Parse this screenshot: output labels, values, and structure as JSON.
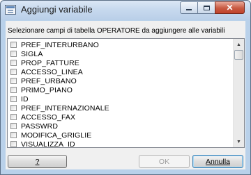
{
  "window": {
    "title": "Aggiungi variabile"
  },
  "titlebar_buttons": {
    "minimize_icon": "minimize-icon",
    "maximize_icon": "maximize-icon",
    "close_glyph": "✕"
  },
  "instruction": "Selezionare campi di tabella OPERATORE da aggiungere alle variabili",
  "list": {
    "items": [
      {
        "label": "PREF_INTERURBANO",
        "checked": false
      },
      {
        "label": "SIGLA",
        "checked": false
      },
      {
        "label": "PROP_FATTURE",
        "checked": false
      },
      {
        "label": "ACCESSO_LINEA",
        "checked": false
      },
      {
        "label": "PREF_URBANO",
        "checked": false
      },
      {
        "label": "PRIMO_PIANO",
        "checked": false
      },
      {
        "label": "ID",
        "checked": false
      },
      {
        "label": "PREF_INTERNAZIONALE",
        "checked": false
      },
      {
        "label": "ACCESSO_FAX",
        "checked": false
      },
      {
        "label": "PASSWRD",
        "checked": false
      },
      {
        "label": "MODIFICA_GRIGLIE",
        "checked": false
      },
      {
        "label": "VISUALIZZA_ID",
        "checked": false
      }
    ]
  },
  "buttons": {
    "help_label": "?",
    "ok_label": "OK",
    "cancel_label": "Annulla"
  },
  "colors": {
    "titlebar": "#c7d9ee",
    "close_button": "#c85a42",
    "dialog_background": "#f0f0f0",
    "default_button_border": "#3c7fb1"
  }
}
